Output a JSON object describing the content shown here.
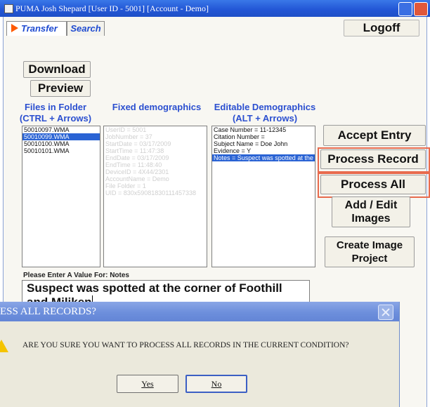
{
  "window": {
    "title": "PUMA  Josh Shepard [User ID - 5001] [Account - Demo]",
    "icons": {
      "app": "app-icon",
      "minimize": "minimize-icon",
      "close": "close-icon"
    }
  },
  "tabs": [
    {
      "label": "Transfer"
    },
    {
      "label": "Search"
    }
  ],
  "toolbar": {
    "logoff": "Logoff",
    "download": "Download",
    "preview": "Preview"
  },
  "headers": {
    "files": "Files in Folder (CTRL + Arrows)",
    "fixed": "Fixed demographics",
    "editable": "Editable Demographics (ALT + Arrows)"
  },
  "files": [
    {
      "name": "50010097.WMA",
      "selected": false
    },
    {
      "name": "50010099.WMA",
      "selected": true
    },
    {
      "name": "50010100.WMA",
      "selected": false
    },
    {
      "name": "50010101.WMA",
      "selected": false
    }
  ],
  "fixed": [
    "UserID = 5001",
    "JobNumber = 37",
    "StartDate = 03/17/2009",
    "StartTime = 11:47:38",
    "EndDate = 03/17/2009",
    "EndTime = 11:48:40",
    "DeviceID = 4X44/2301",
    "AccountName = Demo",
    "File Folder = 1",
    "UID = 830x59081830111457338"
  ],
  "editable": [
    {
      "text": "Case Number = 11-12345",
      "selected": false
    },
    {
      "text": "Citation Number =",
      "selected": false
    },
    {
      "text": "Subject Name = Doe John",
      "selected": false
    },
    {
      "text": "Evidence = Y",
      "selected": false
    },
    {
      "text": "Notes = Suspect was spotted at the co",
      "selected": true
    }
  ],
  "actions": {
    "accept": "Accept Entry",
    "process_record": "Process Record",
    "process_all": "Process All",
    "add_edit_images": "Add / Edit Images",
    "create_image_project": "Create Image Project"
  },
  "prompt": {
    "label": "Please Enter A Value For: Notes",
    "value": "Suspect was spotted at the corner of Foothill and Miliken"
  },
  "dialog": {
    "title": "ESS ALL RECORDS?",
    "message": "ARE YOU SURE YOU WANT TO PROCESS ALL RECORDS IN THE CURRENT CONDITION?",
    "yes": "Yes",
    "no": "No"
  },
  "colors": {
    "title_bar": "#2357d6",
    "accent_text": "#2b4fd0",
    "selection": "#2a63d4",
    "highlight_box": "#e86b4e",
    "tab_arrow": "#ff5a00"
  }
}
